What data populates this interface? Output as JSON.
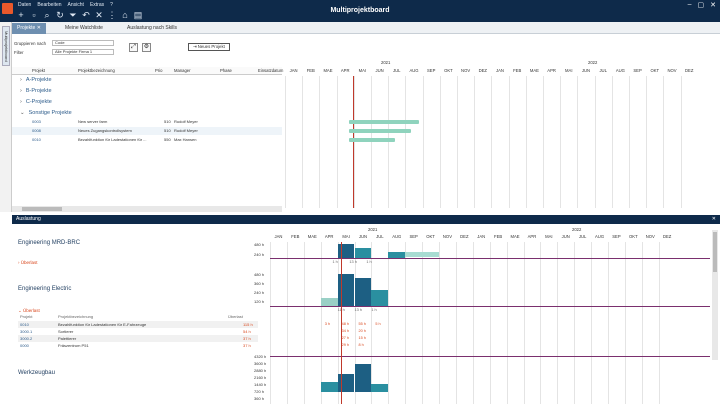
{
  "app": {
    "title": "Multiprojektboard",
    "menus": [
      "Daten",
      "Bearbeiten",
      "Ansicht",
      "Extras",
      "?"
    ]
  },
  "sidebar": {
    "vertical_tab": "Multiprojektboard"
  },
  "tabs": [
    {
      "label": "Projekte",
      "active": true
    },
    {
      "label": "Meine Watchliste",
      "active": false
    },
    {
      "label": "Auslastung nach Skills",
      "active": false
    }
  ],
  "filters": {
    "group_label": "Gruppieren nach",
    "group_value": "Code",
    "filter_label": "Filter",
    "filter_value": "Alle Projekte Firma 1",
    "new_project": "Neues Projekt"
  },
  "grid_headers": [
    "Projekt",
    "Projektbezeichnung",
    "Prio",
    "Manager",
    "Phase",
    "Einsatzdatum"
  ],
  "groups": [
    "A-Projekte",
    "B-Projekte",
    "C-Projekte",
    "Sonstige Projekte"
  ],
  "projects": [
    {
      "code": "0003",
      "name": "New server farm",
      "prio": "510",
      "manager": "Rudolf Meyer"
    },
    {
      "code": "0008",
      "name": "Neues Zugangskontrollsystem",
      "prio": "510",
      "manager": "Rudolf Meyer"
    },
    {
      "code": "0010",
      "name": "Bezahlfunktion für Ladestationen für ...",
      "prio": "550",
      "manager": "Max Hansen"
    }
  ],
  "years": [
    "2021",
    "2022"
  ],
  "months": [
    "JAN",
    "FEB",
    "MAE",
    "APR",
    "MAI",
    "JUN",
    "JUL",
    "AUG",
    "SEP",
    "OKT",
    "NOV",
    "DEZ",
    "JAN",
    "FEB",
    "MAE",
    "APR",
    "MAI",
    "JUN",
    "JUL",
    "AUG",
    "SEP",
    "OKT",
    "NOV",
    "DEZ"
  ],
  "lower": {
    "title": "Auslastung",
    "sections": [
      "Engineering MRD-BRC",
      "Engineering Electric",
      "Werkzeugbau"
    ],
    "overload_label": "Überlast",
    "overload_headers": [
      "Projekt",
      "Projektbezeichnung",
      "Überlast"
    ],
    "overload_rows": [
      {
        "code": "0010",
        "name": "Bezahlfunktion für Ladestationen für E-Fahrzeuge",
        "value": "115 h"
      },
      {
        "code": "3000.1",
        "name": "Sortierer",
        "value": "54 h"
      },
      {
        "code": "3000.2",
        "name": "Palettierer",
        "value": "37 h"
      },
      {
        "code": "0000",
        "name": "Fräszentrum P51",
        "value": "37 h"
      }
    ],
    "ylabels_a": [
      "480 h",
      "240 h"
    ],
    "ylabels_b": [
      "480 h",
      "360 h",
      "240 h",
      "120 h"
    ],
    "ylabels_c": [
      "4320 h",
      "3600 h",
      "2880 h",
      "2160 h",
      "1440 h",
      "720 h",
      "360 h"
    ],
    "cell_values_a": [
      "1 h",
      "13 h",
      "1 h"
    ],
    "cell_values_b": [
      "3 h",
      "48 h",
      "55 h",
      "5 h",
      "34 h",
      "20 h",
      "27 h",
      "15 h",
      "29 h",
      "8 h"
    ],
    "cell_values_c": [
      "11 h",
      "13 h",
      "1 h"
    ]
  },
  "colors": {
    "header": "#0e2a4a",
    "bar": "#8fd3bd",
    "tab_active": "#6e8fb0",
    "load_dark": "#1d5f83",
    "load_mid": "#2a8fa0",
    "overload_text": "#d9481e"
  }
}
